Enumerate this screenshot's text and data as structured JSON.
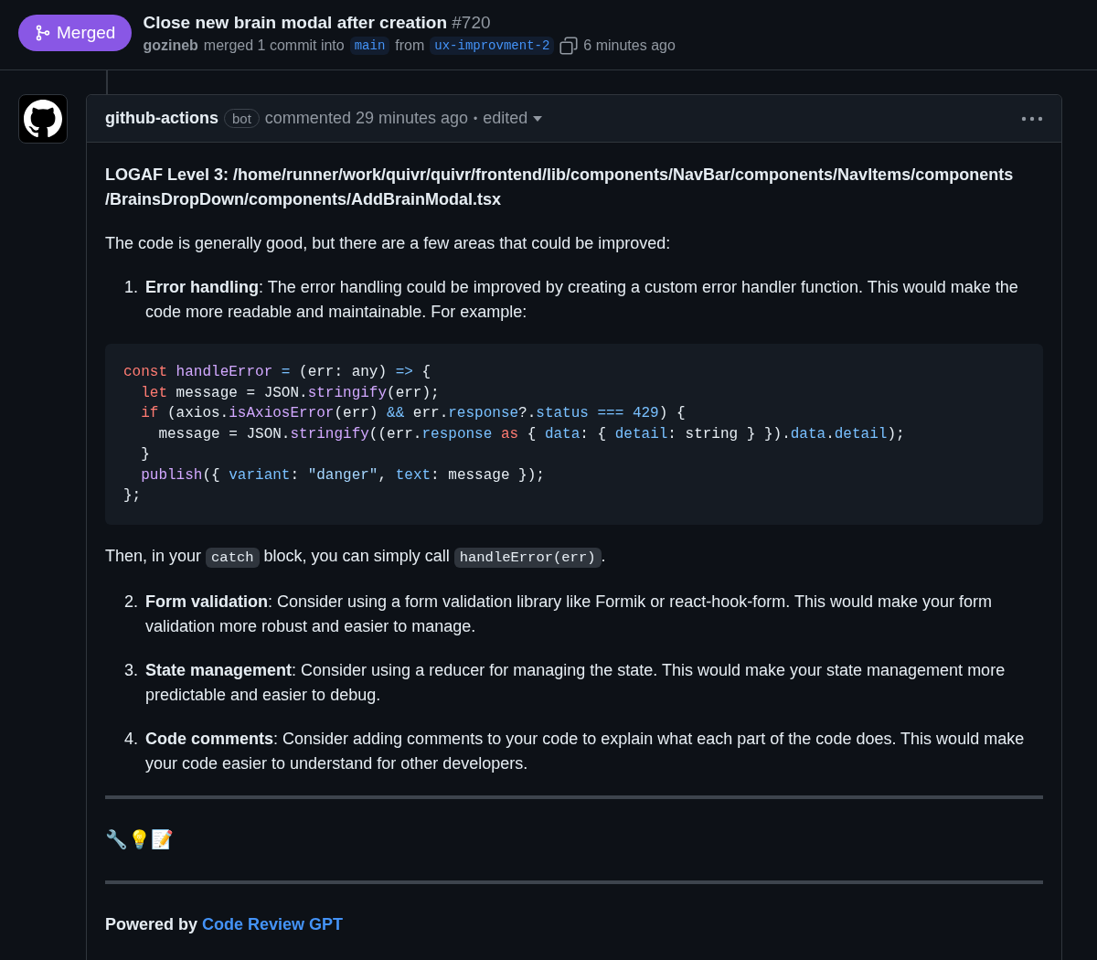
{
  "pr_header": {
    "status": "Merged",
    "title": "Close new brain modal after creation",
    "number": "#720",
    "author": "gozineb",
    "action": "merged 1 commit into",
    "base_branch": "main",
    "from_word": "from",
    "head_branch": "ux-improvment-2",
    "time": "6 minutes ago"
  },
  "comment": {
    "author": "github-actions",
    "badge": "bot",
    "meta": "commented 29 minutes ago",
    "separator": "•",
    "edited": "edited",
    "blocks": [
      {
        "kind": "heading",
        "text": "LOGAF Level 3: /home/runner/work/quivr/quivr/frontend/lib/components/NavBar/components/NavItems/components /BrainsDropDown/components/AddBrainModal.tsx"
      },
      {
        "kind": "paragraph",
        "parts": [
          {
            "kind": "text",
            "text": "The code is generally good, but there are a few areas that could be improved:"
          }
        ]
      },
      {
        "kind": "list_item",
        "number": "1.",
        "text": "**Error handling**: The error handling could be improved by creating a custom error handler function. This would make the code more readable and maintainable. For example:"
      },
      {
        "kind": "code",
        "lines": [
          [
            {
              "kind": "kw",
              "text": "const"
            },
            {
              "kind": "fn",
              "text": " handleError"
            },
            {
              "kind": "const",
              "text": " ="
            },
            {
              "kind": "plain",
              "text": " (err: any) "
            },
            {
              "kind": "const",
              "text": "=>"
            },
            {
              "kind": "plain",
              "text": " {"
            }
          ],
          [
            {
              "kind": "kw",
              "text": "  let"
            },
            {
              "kind": "plain",
              "text": " message = JSON."
            },
            {
              "kind": "fn",
              "text": "stringify"
            },
            {
              "kind": "plain",
              "text": "(err);"
            }
          ],
          [
            {
              "kind": "kw",
              "text": "  if"
            },
            {
              "kind": "plain",
              "text": " (axios."
            },
            {
              "kind": "fn",
              "text": "isAxiosError"
            },
            {
              "kind": "plain",
              "text": "(err) "
            },
            {
              "kind": "const",
              "text": "&&"
            },
            {
              "kind": "plain",
              "text": " err."
            },
            {
              "kind": "const",
              "text": "response"
            },
            {
              "kind": "plain",
              "text": "?."
            },
            {
              "kind": "const",
              "text": "status"
            },
            {
              "kind": "const",
              "text": " ==="
            },
            {
              "kind": "const",
              "text": " 429"
            },
            {
              "kind": "plain",
              "text": ") {"
            }
          ],
          [
            {
              "kind": "plain",
              "text": "    message = JSON."
            },
            {
              "kind": "fn",
              "text": "stringify"
            },
            {
              "kind": "plain",
              "text": "((err."
            },
            {
              "kind": "const",
              "text": "response"
            },
            {
              "kind": "kw",
              "text": " as"
            },
            {
              "kind": "plain",
              "text": " { "
            },
            {
              "kind": "const",
              "text": "data"
            },
            {
              "kind": "plain",
              "text": ": { "
            },
            {
              "kind": "const",
              "text": "detail"
            },
            {
              "kind": "plain",
              "text": ": string } })."
            },
            {
              "kind": "const",
              "text": "data"
            },
            {
              "kind": "plain",
              "text": "."
            },
            {
              "kind": "const",
              "text": "detail"
            },
            {
              "kind": "plain",
              "text": ");"
            }
          ],
          [
            {
              "kind": "plain",
              "text": "  }"
            }
          ],
          [
            {
              "kind": "fn",
              "text": "  publish"
            },
            {
              "kind": "plain",
              "text": "({ "
            },
            {
              "kind": "const",
              "text": "variant"
            },
            {
              "kind": "plain",
              "text": ": "
            },
            {
              "kind": "str",
              "text": "\"danger\""
            },
            {
              "kind": "plain",
              "text": ", "
            },
            {
              "kind": "const",
              "text": "text"
            },
            {
              "kind": "plain",
              "text": ": message });"
            }
          ],
          [
            {
              "kind": "plain",
              "text": "};"
            }
          ]
        ]
      },
      {
        "kind": "paragraph",
        "parts": [
          {
            "kind": "text",
            "text": "Then, in your "
          },
          {
            "kind": "code",
            "text": "catch"
          },
          {
            "kind": "text",
            "text": " block, you can simply call "
          },
          {
            "kind": "code",
            "text": "handleError(err)"
          },
          {
            "kind": "text",
            "text": "."
          }
        ]
      },
      {
        "kind": "list_item",
        "number": "2.",
        "text": "**Form validation**: Consider using a form validation library like Formik or react-hook-form. This would make your form validation more robust and easier to manage."
      },
      {
        "kind": "list_item",
        "number": "3.",
        "text": "**State management**: Consider using a reducer for managing the state. This would make your state management more predictable and easier to debug."
      },
      {
        "kind": "list_item",
        "number": "4.",
        "text": "**Code comments**: Consider adding comments to your code to explain what each part of the code does. This would make your code easier to understand for other developers."
      },
      {
        "kind": "rule"
      },
      {
        "kind": "emoji",
        "text": "🔧💡📝"
      },
      {
        "kind": "rule"
      },
      {
        "kind": "footer",
        "text": "Powered by",
        "link": "Code Review GPT"
      }
    ]
  }
}
